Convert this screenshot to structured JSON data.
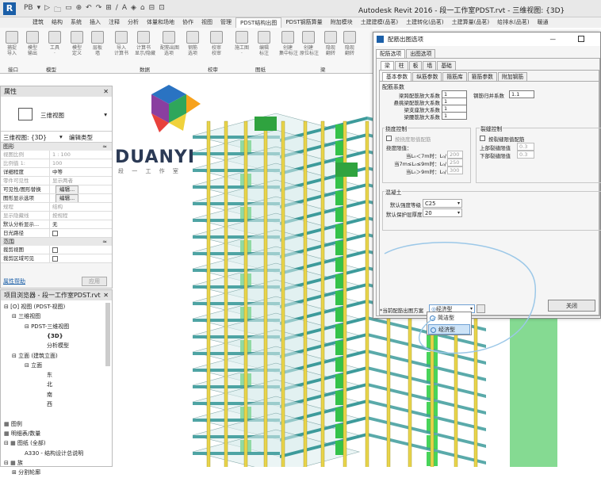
{
  "app": {
    "title": "Autodesk Revit 2016 -   段一工作室PDST.rvt - 三维视图: {3D}",
    "logo_letter": "R",
    "qat_items": [
      "PB",
      "▾",
      "▷",
      "🗀",
      "▭",
      "⊕",
      "↶",
      "↷",
      "⊞",
      "/",
      "A",
      "◈",
      "⌂",
      "⊟",
      "⊡"
    ]
  },
  "ribbon": {
    "tabs": [
      "建筑",
      "结构",
      "系统",
      "插入",
      "注释",
      "分析",
      "体量和场地",
      "协作",
      "视图",
      "管理",
      "PDST结构出图",
      "PDST钢筋算量",
      "附加模块",
      "土建建模(品茗)",
      "土建转化(品茗)",
      "土建算量(品茗)",
      "给排水(品茗)",
      "暖通"
    ],
    "active_tab": "PDST结构出图",
    "buttons": [
      {
        "label": "捕捉\n导入"
      },
      {
        "label": "模型\n输出"
      },
      {
        "label": "工具\n·"
      },
      {
        "label": "模型\n定义"
      },
      {
        "label": "层板\n墙"
      },
      {
        "label": "导入\n计算书"
      },
      {
        "label": "计算书\n显示/隐藏"
      },
      {
        "label": "配筋出图\n选项"
      },
      {
        "label": "钢筋\n选项"
      },
      {
        "label": "校审\n校审"
      },
      {
        "label": "施工图\n·"
      },
      {
        "label": "编辑\n标注"
      },
      {
        "label": "创建\n集中标注"
      },
      {
        "label": "创建\n原位标注"
      },
      {
        "label": "隐现\n翻转"
      },
      {
        "label": "隐现\n翻转"
      }
    ],
    "groups": [
      "接口",
      "模型",
      "数据",
      "校审",
      "图纸",
      "梁"
    ]
  },
  "properties": {
    "title": "属性",
    "type_name": "三维视图",
    "selector": "三维视图: {3D}",
    "edit_type": "编辑类型",
    "category": "图形",
    "rows": [
      {
        "k": "视图比例",
        "v": "1 : 100",
        "dim": true
      },
      {
        "k": "比例值 1:",
        "v": "100",
        "dim": true
      },
      {
        "k": "详细程度",
        "v": "中等",
        "dim": false
      },
      {
        "k": "零件可见性",
        "v": "显示两者",
        "dim": true
      },
      {
        "k": "可见性/图形替换",
        "v": "编辑...",
        "dim": false,
        "btn": true
      },
      {
        "k": "图形显示选项",
        "v": "编辑...",
        "dim": false,
        "btn": true
      },
      {
        "k": "规程",
        "v": "结构",
        "dim": true
      },
      {
        "k": "显示隐藏线",
        "v": "按规程",
        "dim": true
      },
      {
        "k": "默认分析显示...",
        "v": "无",
        "dim": false
      },
      {
        "k": "日光路径",
        "v": "",
        "dim": false,
        "chk": true
      }
    ],
    "category2": "范围",
    "rows2": [
      {
        "k": "裁剪视图",
        "v": "",
        "chk": true
      },
      {
        "k": "裁剪区域可见",
        "v": "",
        "chk": true
      }
    ],
    "help": "属性帮助",
    "apply": "应用"
  },
  "browser": {
    "title": "项目浏览器 - 段一工作室PDST.rvt",
    "items": [
      {
        "t": "⊟ [O] 视图 (PDST-视图)",
        "x": 4
      },
      {
        "t": "⊟  三维视图",
        "x": 14
      },
      {
        "t": "⊟  PDST-三维视图",
        "x": 30
      },
      {
        "t": "{3D}",
        "x": 58,
        "bold": true
      },
      {
        "t": "分析模型",
        "x": 58
      },
      {
        "t": "⊟  立面 (建筑立面)",
        "x": 14
      },
      {
        "t": "⊟  立面",
        "x": 30
      },
      {
        "t": "东",
        "x": 58
      },
      {
        "t": "北",
        "x": 58
      },
      {
        "t": "南",
        "x": 58
      },
      {
        "t": "西",
        "x": 58
      },
      {
        "t": "",
        "x": 4
      },
      {
        "t": "▦ 图例",
        "x": 4
      },
      {
        "t": "▦ 明细表/数量",
        "x": 4
      },
      {
        "t": "⊟ ▦ 图纸 (全部)",
        "x": 4
      },
      {
        "t": "A330 - 结构设计总说明",
        "x": 30
      },
      {
        "t": "⊟ ▦ 族",
        "x": 4
      },
      {
        "t": "⊞  分割轮廓",
        "x": 14
      }
    ]
  },
  "logo": {
    "brand": "DUANYI",
    "sub": "段 一 工 作 室",
    "colors": [
      "#e8413c",
      "#f7a21c",
      "#2fa65b",
      "#2a73c2",
      "#8a3fa0",
      "#f0d23c"
    ]
  },
  "dialog": {
    "title": "配筋出图选项",
    "min": "—",
    "tabs_top": [
      "配筋选项",
      "出图选项"
    ],
    "tabs_elem": [
      "梁",
      "柱",
      "板",
      "墙",
      "基础"
    ],
    "tabs_sub": [
      "基本参数",
      "纵筋参数",
      "箍筋库",
      "箍筋参数",
      "附加钢筋"
    ],
    "section_coef": "配筋系数",
    "coef_rows": [
      {
        "label": "梁跨配筋放大系数",
        "value": "1"
      },
      {
        "label": "悬挑梁配筋放大系数",
        "value": "1"
      },
      {
        "label": "梁支座放大系数",
        "value": "1"
      },
      {
        "label": "梁腰筋放大系数",
        "value": "1"
      }
    ],
    "combine_label": "钢筋归并系数",
    "combine_value": "1.1",
    "deflect_title": "挠度控制",
    "deflect_check": "按挠度限值配筋",
    "deflect_limit": "挠度限值：",
    "deflect_rows": [
      {
        "label": "当L₀＜7m时：L₀/",
        "value": "200"
      },
      {
        "label": "当7m≤L₀≤9m时：L₀/",
        "value": "250"
      },
      {
        "label": "当L₀＞9m时：L₀/",
        "value": "300"
      }
    ],
    "crack_title": "裂缝控制",
    "crack_check": "按裂缝限值配筋",
    "crack_rows": [
      {
        "label": "上部裂缝限值",
        "value": "0.3"
      },
      {
        "label": "下部裂缝限值",
        "value": "0.3"
      }
    ],
    "concrete_title": "混凝土",
    "concrete_rows": [
      {
        "label": "默认强度等级",
        "value": "C25"
      },
      {
        "label": "默认保护层厚度",
        "value": "20"
      }
    ],
    "scheme_label": "*当前配筋出图方案",
    "scheme_value": "经济型",
    "close": "关闭",
    "options": [
      "简洁型",
      "经济型"
    ],
    "selected_option": "经济型"
  }
}
